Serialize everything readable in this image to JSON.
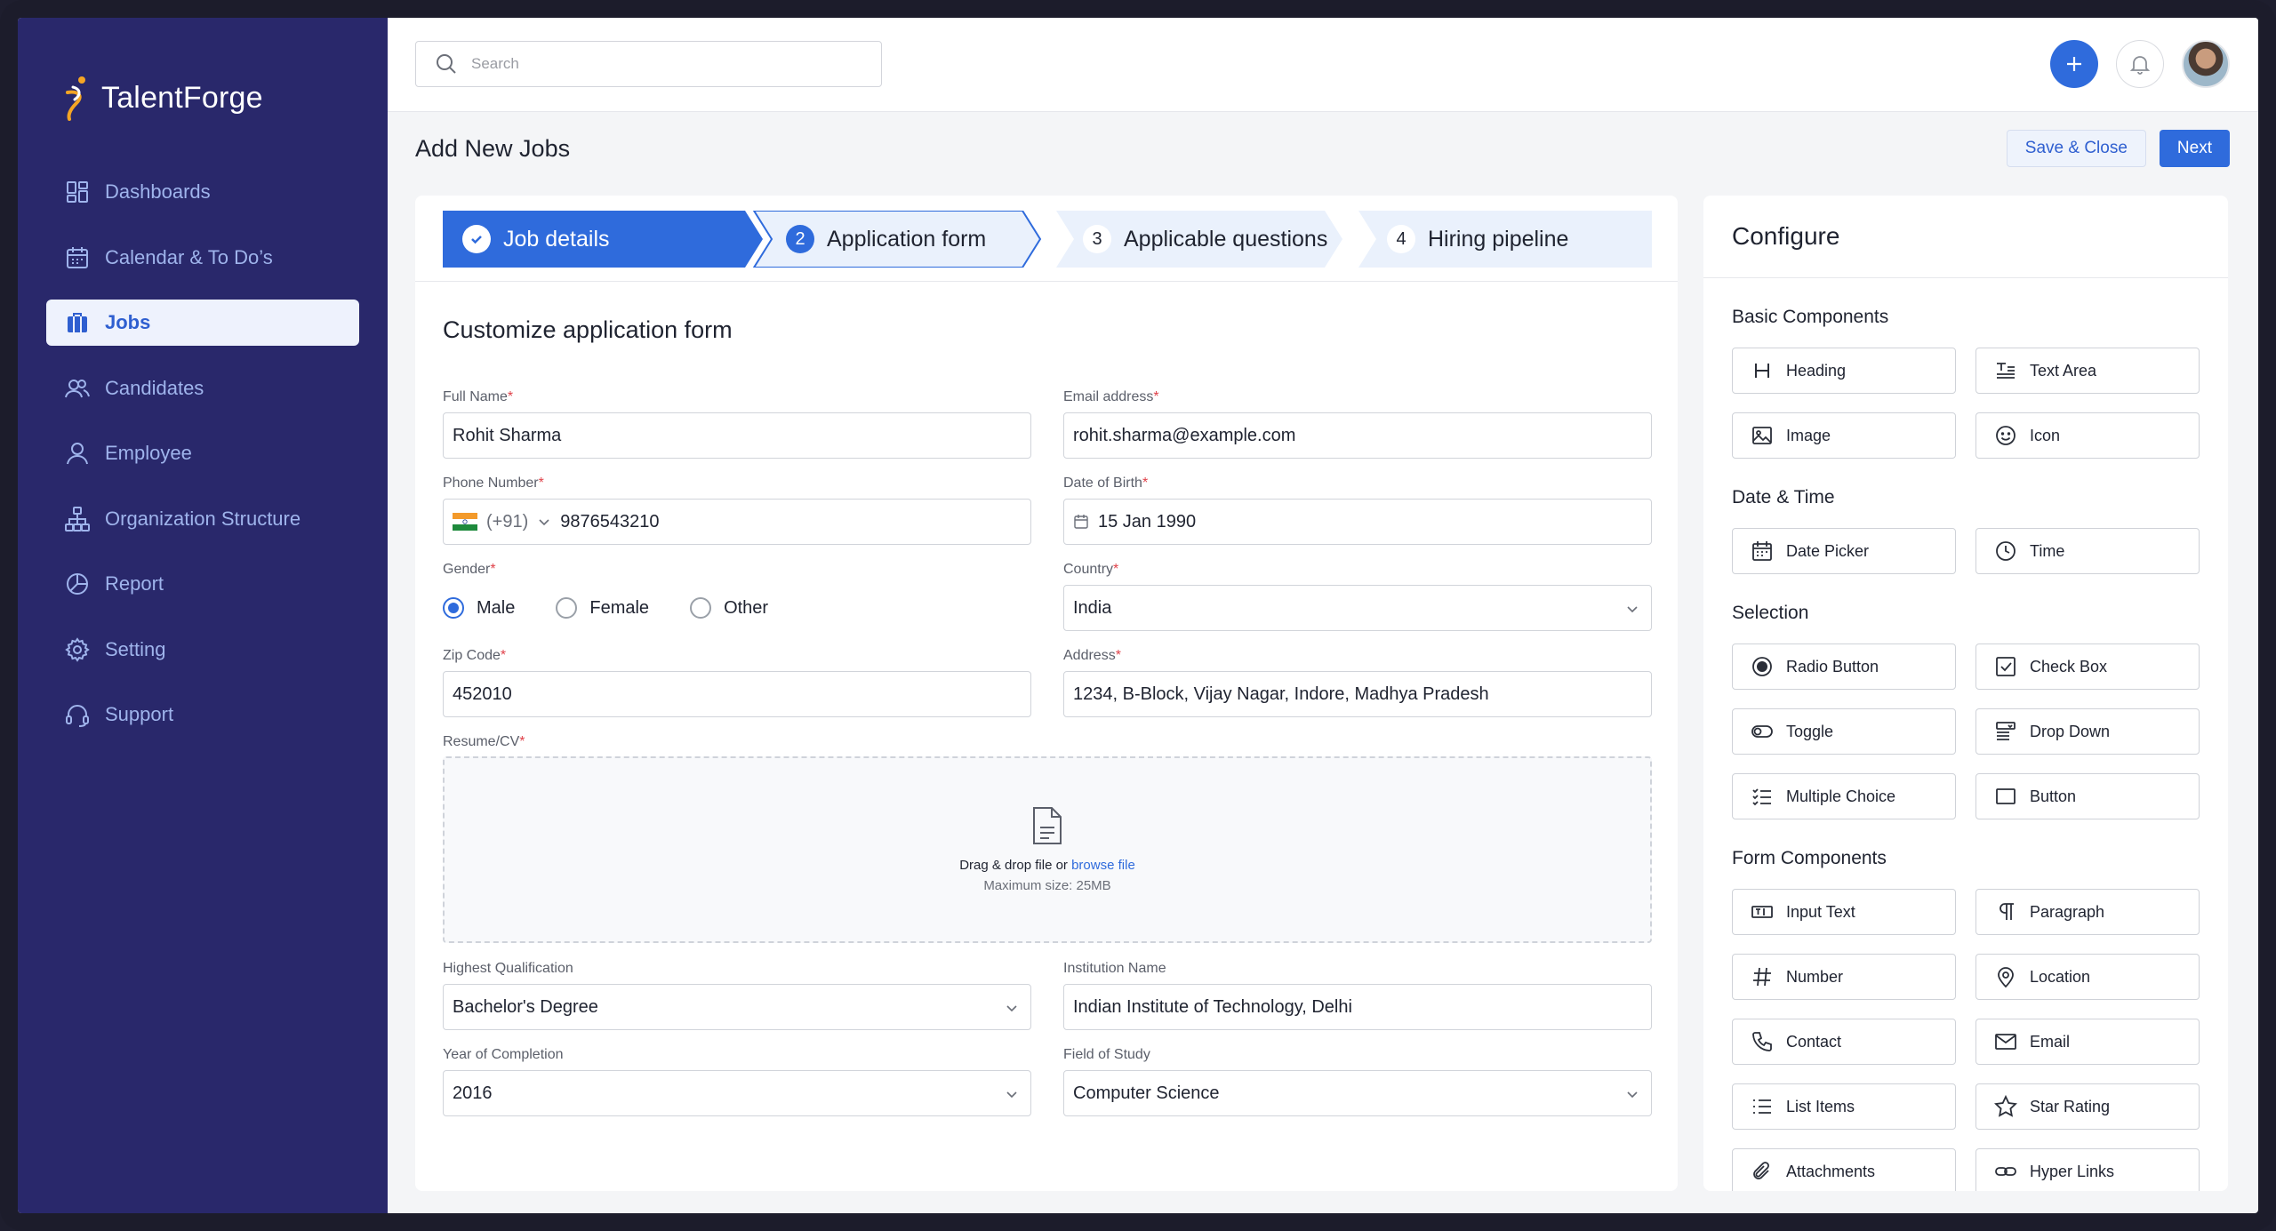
{
  "app": {
    "name": "TalentForge"
  },
  "sidebar": {
    "items": [
      {
        "label": "Dashboards",
        "icon": "dashboard-icon",
        "active": false
      },
      {
        "label": "Calendar & To Do’s",
        "icon": "calendar-icon",
        "active": false
      },
      {
        "label": "Jobs",
        "icon": "briefcase-icon",
        "active": true
      },
      {
        "label": "Candidates",
        "icon": "users-icon",
        "active": false
      },
      {
        "label": "Employee",
        "icon": "user-icon",
        "active": false
      },
      {
        "label": "Organization Structure",
        "icon": "org-chart-icon",
        "active": false
      },
      {
        "label": "Report",
        "icon": "pie-chart-icon",
        "active": false
      },
      {
        "label": "Setting",
        "icon": "gear-icon",
        "active": false
      },
      {
        "label": "Support",
        "icon": "headset-icon",
        "active": false
      }
    ]
  },
  "topbar": {
    "search_placeholder": "Search"
  },
  "header": {
    "title": "Add New Jobs",
    "save_close_label": "Save & Close",
    "next_label": "Next"
  },
  "stepper": {
    "steps": [
      {
        "num": "1",
        "label": "Job details",
        "state": "complete"
      },
      {
        "num": "2",
        "label": "Application form",
        "state": "current"
      },
      {
        "num": "3",
        "label": "Applicable questions",
        "state": "upcoming"
      },
      {
        "num": "4",
        "label": "Hiring pipeline",
        "state": "upcoming"
      }
    ]
  },
  "form": {
    "title": "Customize application form",
    "full_name": {
      "label": "Full Name",
      "value": "Rohit Sharma"
    },
    "email": {
      "label": "Email address",
      "value": "rohit.sharma@example.com"
    },
    "phone": {
      "label": "Phone Number",
      "code": "(+91)",
      "value": "9876543210"
    },
    "dob": {
      "label": "Date of Birth",
      "value": "15 Jan 1990"
    },
    "gender": {
      "label": "Gender",
      "options": [
        "Male",
        "Female",
        "Other"
      ],
      "selected": "Male"
    },
    "country": {
      "label": "Country",
      "value": "India"
    },
    "zip": {
      "label": "Zip Code",
      "value": "452010"
    },
    "address": {
      "label": "Address",
      "value": "1234, B-Block, Vijay Nagar, Indore, Madhya Pradesh"
    },
    "resume": {
      "label": "Resume/CV",
      "drag_text": "Drag & drop file or ",
      "browse_text": "browse file",
      "max_size": "Maximum size: 25MB"
    },
    "qualification": {
      "label": "Highest Qualification",
      "value": "Bachelor's Degree"
    },
    "institution": {
      "label": "Institution Name",
      "value": "Indian Institute of Technology, Delhi"
    },
    "year": {
      "label": "Year of Completion",
      "value": "2016"
    },
    "field_of_study": {
      "label": "Field of Study",
      "value": "Computer Science"
    },
    "required_mark": "*"
  },
  "configure": {
    "title": "Configure",
    "groups": [
      {
        "title": "Basic Components",
        "items": [
          {
            "label": "Heading",
            "icon": "heading-icon"
          },
          {
            "label": "Text Area",
            "icon": "text-area-icon"
          },
          {
            "label": "Image",
            "icon": "image-icon"
          },
          {
            "label": "Icon",
            "icon": "smiley-icon"
          }
        ]
      },
      {
        "title": "Date & Time",
        "items": [
          {
            "label": "Date Picker",
            "icon": "calendar-icon"
          },
          {
            "label": "Time",
            "icon": "clock-icon"
          }
        ]
      },
      {
        "title": "Selection",
        "items": [
          {
            "label": "Radio Button",
            "icon": "radio-icon"
          },
          {
            "label": "Check Box",
            "icon": "checkbox-icon"
          },
          {
            "label": "Toggle",
            "icon": "toggle-icon"
          },
          {
            "label": "Drop Down",
            "icon": "dropdown-icon"
          },
          {
            "label": "Multiple Choice",
            "icon": "checklist-icon"
          },
          {
            "label": "Button",
            "icon": "button-icon"
          }
        ]
      },
      {
        "title": "Form Components",
        "items": [
          {
            "label": "Input Text",
            "icon": "input-text-icon"
          },
          {
            "label": "Paragraph",
            "icon": "paragraph-icon"
          },
          {
            "label": "Number",
            "icon": "hash-icon"
          },
          {
            "label": "Location",
            "icon": "location-pin-icon"
          },
          {
            "label": "Contact",
            "icon": "phone-icon"
          },
          {
            "label": "Email",
            "icon": "mail-icon"
          },
          {
            "label": "List Items",
            "icon": "list-icon"
          },
          {
            "label": "Star Rating",
            "icon": "star-icon"
          },
          {
            "label": "Attachments",
            "icon": "paperclip-icon"
          },
          {
            "label": "Hyper Links",
            "icon": "link-icon"
          }
        ]
      }
    ]
  },
  "colors": {
    "sidebar_bg": "#29286b",
    "primary": "#2f6bdc",
    "active_step": "#2f6bdc",
    "required": "#e0424a"
  }
}
